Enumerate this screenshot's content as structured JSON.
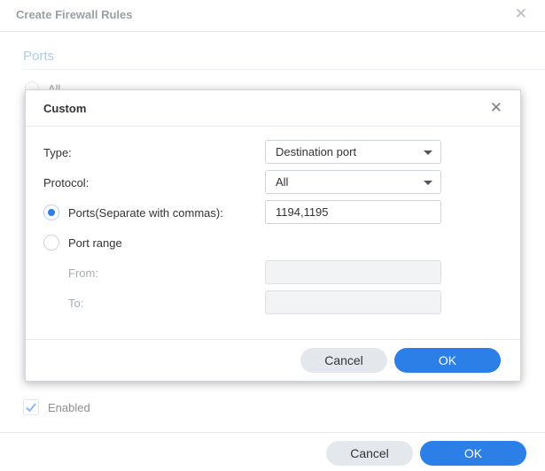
{
  "background_dialog": {
    "title": "Create Firewall Rules",
    "close_glyph": "✕",
    "section_title": "Ports",
    "all_label": "All",
    "enabled_label": "Enabled",
    "enabled_checked": true,
    "cancel_label": "Cancel",
    "ok_label": "OK"
  },
  "custom_dialog": {
    "title": "Custom",
    "close_glyph": "✕",
    "type_label": "Type:",
    "type_value": "Destination port",
    "protocol_label": "Protocol:",
    "protocol_value": "All",
    "ports_radio_label": "Ports(Separate with commas):",
    "ports_value": "1194,1195",
    "port_range_label": "Port range",
    "from_label": "From:",
    "from_value": "",
    "to_label": "To:",
    "to_value": "",
    "cancel_label": "Cancel",
    "ok_label": "OK"
  },
  "colors": {
    "accent": "#2d7fe8",
    "section_blue": "#6aa0d8",
    "button_gray": "#e4e8ed"
  },
  "icons": {
    "close": "close-icon",
    "dropdown": "chevron-down-icon",
    "check": "check-icon"
  }
}
